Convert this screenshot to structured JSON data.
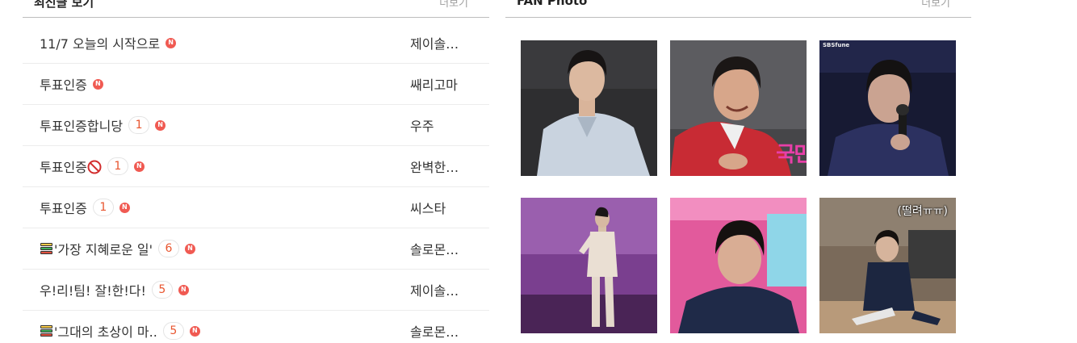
{
  "left_section": {
    "title": "최신글 보기",
    "more_label": "더보기",
    "posts": [
      {
        "title": "11/7 오늘의 시작으로",
        "comments": "",
        "is_new": true,
        "author": "제이솔…",
        "icon": ""
      },
      {
        "title": "투표인증",
        "comments": "",
        "is_new": true,
        "author": "쌔리고마",
        "icon": ""
      },
      {
        "title": "투표인증합니당",
        "comments": "1",
        "is_new": true,
        "author": "우주",
        "icon": ""
      },
      {
        "title": "투표인증",
        "comments": "1",
        "is_new": true,
        "author": "완벽한…",
        "icon": "prohibited-emoji-icon"
      },
      {
        "title": "투표인증",
        "comments": "1",
        "is_new": true,
        "author": "씨스타",
        "icon": ""
      },
      {
        "title": "'가장 지혜로운 일'",
        "comments": "6",
        "is_new": true,
        "author": "솔로몬…",
        "icon": "books-emoji-icon"
      },
      {
        "title": "우!리!팀! 잘!한!다!",
        "comments": "5",
        "is_new": true,
        "author": "제이솔…",
        "icon": ""
      },
      {
        "title": "'그대의 초상이 마..",
        "comments": "5",
        "is_new": true,
        "author": "솔로몬…",
        "icon": "books-emoji-icon"
      }
    ],
    "new_badge_text": "N"
  },
  "right_section": {
    "title": "FAN Photo",
    "more_label": "더보기",
    "photos": [
      {
        "caption": "",
        "watermark": "",
        "overlay": ""
      },
      {
        "caption": "",
        "watermark": "",
        "overlay": "국민"
      },
      {
        "caption": "",
        "watermark": "SBSfune",
        "overlay": ""
      },
      {
        "caption": "",
        "watermark": "",
        "overlay": ""
      },
      {
        "caption": "",
        "watermark": "",
        "overlay": ""
      },
      {
        "caption": "(떨려ㅠㅠ)",
        "watermark": "",
        "overlay": ""
      }
    ]
  },
  "colors": {
    "comment_count": "#e8552f",
    "new_badge": "#f05a52",
    "header_border": "#bdbdbd"
  }
}
